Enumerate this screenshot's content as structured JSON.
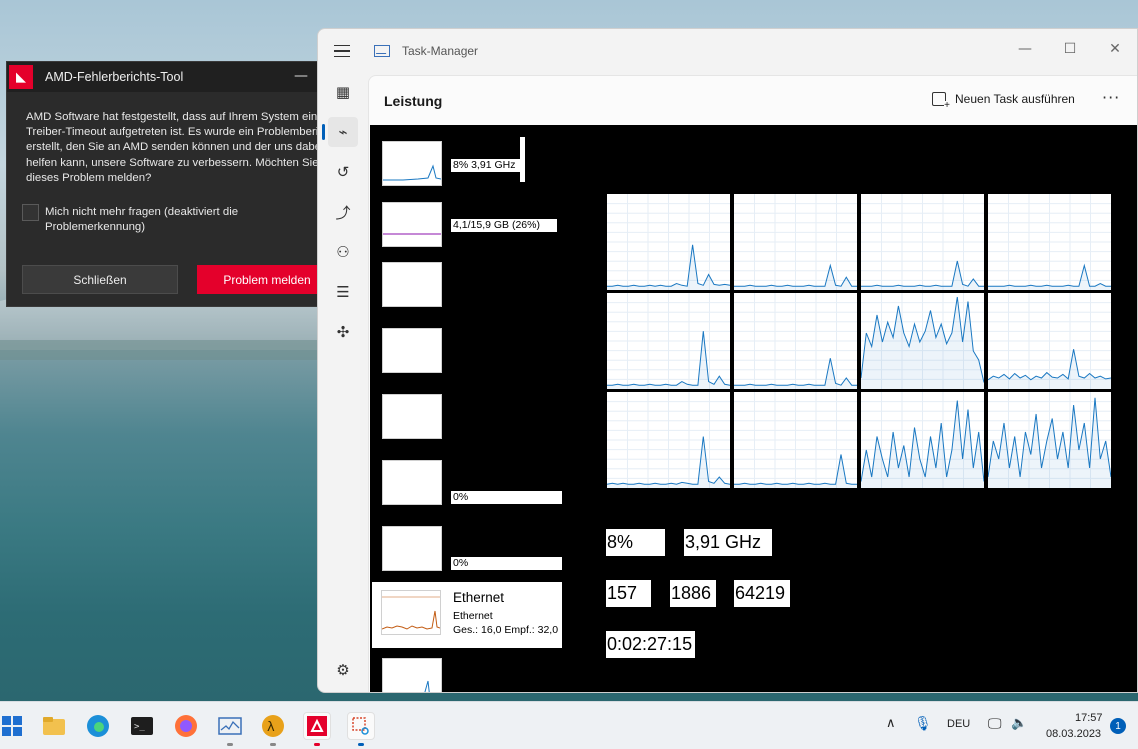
{
  "amd_dialog": {
    "title": "AMD-Fehlerberichts-Tool",
    "message_lines": [
      "AMD Software hat festgestellt, dass auf Ihrem System ein",
      "Treiber-Timeout aufgetreten ist. Es wurde ein Problembericht",
      "erstellt, den Sie an AMD senden können und der uns dabei",
      "helfen kann, unsere Software zu verbessern. Möchten Sie",
      "dieses Problem melden?"
    ],
    "checkbox_label": "Mich nicht mehr fragen (deaktiviert die Problemerkennung)",
    "close_button": "Schließen",
    "report_button": "Problem melden",
    "colors": {
      "accent": "#e4002b",
      "background": "#2b2b2b"
    }
  },
  "task_manager": {
    "window_title": "Task-Manager",
    "page_title": "Leistung",
    "new_task_label": "Neuen Task ausführen",
    "more_label": "···",
    "sidebar_icons": [
      "hamburger-icon",
      "processes-icon",
      "performance-icon",
      "app-history-icon",
      "startup-apps-icon",
      "users-icon",
      "details-icon",
      "services-icon",
      "settings-icon"
    ],
    "resources": [
      {
        "label": "8%  3,91 GHz"
      },
      {
        "label": "4,1/15,9 GB (26%)"
      },
      {
        "label": ""
      },
      {
        "label": ""
      },
      {
        "label": ""
      },
      {
        "label": "0%"
      },
      {
        "label": "0%"
      },
      {
        "label": ""
      }
    ],
    "ethernet_card": {
      "name": "Ethernet",
      "subtitle": "Ethernet",
      "stats": "Ges.: 16,0 Empf.: 32,0"
    },
    "cpu_cores": [
      {
        "points": [
          0.02,
          0.02,
          0.03,
          0.02,
          0.02,
          0.03,
          0.02,
          0.02,
          0.03,
          0.02,
          0.03,
          0.02,
          0.02,
          0.05,
          0.03,
          0.02,
          0.48,
          0.05,
          0.03,
          0.15,
          0.04,
          0.03,
          0.04,
          0.03
        ]
      },
      {
        "points": [
          0.02,
          0.02,
          0.02,
          0.03,
          0.02,
          0.02,
          0.02,
          0.03,
          0.02,
          0.02,
          0.03,
          0.02,
          0.02,
          0.02,
          0.03,
          0.02,
          0.02,
          0.02,
          0.25,
          0.03,
          0.02,
          0.12,
          0.02,
          0.02
        ]
      },
      {
        "points": [
          0.02,
          0.02,
          0.02,
          0.03,
          0.02,
          0.02,
          0.02,
          0.03,
          0.02,
          0.02,
          0.02,
          0.03,
          0.02,
          0.02,
          0.03,
          0.02,
          0.02,
          0.02,
          0.3,
          0.04,
          0.02,
          0.1,
          0.02,
          0.02
        ]
      },
      {
        "points": [
          0.02,
          0.02,
          0.02,
          0.02,
          0.03,
          0.02,
          0.02,
          0.02,
          0.03,
          0.02,
          0.02,
          0.03,
          0.02,
          0.02,
          0.02,
          0.03,
          0.02,
          0.02,
          0.25,
          0.02,
          0.02,
          0.05,
          0.02,
          0.02
        ]
      },
      {
        "points": [
          0.02,
          0.02,
          0.03,
          0.02,
          0.02,
          0.03,
          0.02,
          0.02,
          0.03,
          0.02,
          0.02,
          0.03,
          0.02,
          0.02,
          0.06,
          0.03,
          0.02,
          0.02,
          0.62,
          0.06,
          0.03,
          0.12,
          0.03,
          0.02
        ]
      },
      {
        "points": [
          0.02,
          0.02,
          0.02,
          0.03,
          0.02,
          0.02,
          0.02,
          0.03,
          0.02,
          0.02,
          0.02,
          0.03,
          0.02,
          0.02,
          0.03,
          0.02,
          0.02,
          0.02,
          0.32,
          0.04,
          0.02,
          0.1,
          0.02,
          0.02
        ]
      },
      {
        "points": [
          0.1,
          0.6,
          0.45,
          0.8,
          0.5,
          0.72,
          0.55,
          0.9,
          0.6,
          0.45,
          0.7,
          0.5,
          0.62,
          0.85,
          0.55,
          0.7,
          0.48,
          0.6,
          1.0,
          0.5,
          0.95,
          0.4,
          0.3,
          0.05
        ]
      },
      {
        "points": [
          0.08,
          0.12,
          0.1,
          0.14,
          0.09,
          0.15,
          0.1,
          0.13,
          0.08,
          0.12,
          0.1,
          0.16,
          0.11,
          0.1,
          0.14,
          0.09,
          0.42,
          0.12,
          0.1,
          0.15,
          0.1,
          0.12,
          0.09,
          0.1
        ]
      },
      {
        "points": [
          0.02,
          0.03,
          0.02,
          0.03,
          0.02,
          0.02,
          0.03,
          0.02,
          0.02,
          0.03,
          0.02,
          0.02,
          0.03,
          0.02,
          0.04,
          0.03,
          0.02,
          0.02,
          0.55,
          0.05,
          0.03,
          0.1,
          0.03,
          0.02
        ]
      },
      {
        "points": [
          0.02,
          0.02,
          0.03,
          0.02,
          0.02,
          0.03,
          0.02,
          0.02,
          0.03,
          0.02,
          0.02,
          0.03,
          0.02,
          0.02,
          0.03,
          0.02,
          0.02,
          0.03,
          0.02,
          0.02,
          0.35,
          0.03,
          0.02,
          0.02
        ]
      },
      {
        "points": [
          0.05,
          0.4,
          0.1,
          0.55,
          0.3,
          0.1,
          0.6,
          0.2,
          0.45,
          0.1,
          0.65,
          0.3,
          0.1,
          0.55,
          0.2,
          0.7,
          0.1,
          0.4,
          0.95,
          0.3,
          0.85,
          0.2,
          0.6,
          0.05
        ]
      },
      {
        "points": [
          0.1,
          0.5,
          0.3,
          0.7,
          0.2,
          0.55,
          0.1,
          0.6,
          0.35,
          0.8,
          0.2,
          0.5,
          0.75,
          0.3,
          0.6,
          0.2,
          0.9,
          0.4,
          0.7,
          0.2,
          0.98,
          0.3,
          0.5,
          0.1
        ]
      }
    ],
    "stats": {
      "utilization": "8%",
      "speed": "3,91 GHz",
      "processes": "157",
      "threads": "1886",
      "handles": "64219",
      "uptime": "0:02:27:15"
    },
    "colors": {
      "cpu_line": "#1a78c2",
      "memory_line": "#8b12ae",
      "ethernet_line": "#c25b12"
    }
  },
  "taskbar": {
    "apps": [
      "windows-start-icon",
      "file-explorer-icon",
      "edge-icon",
      "terminal-icon",
      "firefox-icon",
      "task-manager-icon",
      "half-life-icon",
      "amd-icon",
      "snipping-tool-icon"
    ],
    "language": "DEU",
    "time": "17:57",
    "date": "08.03.2023",
    "notifications": "1"
  }
}
